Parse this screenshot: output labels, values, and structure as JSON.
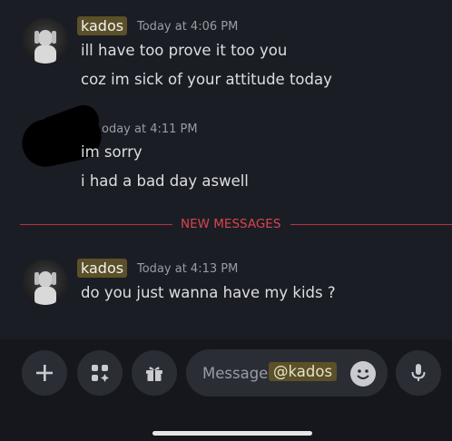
{
  "messages": [
    {
      "username": "kados",
      "timestamp": "Today at 4:06 PM",
      "lines": [
        "ill have too prove it too you",
        "coz im sick of your attitude today"
      ]
    },
    {
      "timestamp_visible": "oday at 4:11 PM",
      "lines": [
        "im sorry",
        "i had a bad day aswell"
      ]
    },
    {
      "username": "kados",
      "timestamp": "Today at 4:13 PM",
      "lines": [
        "do you just wanna have my kids ?"
      ]
    }
  ],
  "divider": {
    "label": "NEW MESSAGES",
    "color": "#d8454e"
  },
  "composer": {
    "placeholder": "Message",
    "mention": "@kados",
    "buttons": [
      "plus-icon",
      "apps-icon",
      "gift-icon",
      "emoji-icon",
      "microphone-icon"
    ]
  },
  "colors": {
    "background": "#1b1d24",
    "mention_highlight": "#5b5027",
    "input_bg": "#2a2d34"
  }
}
